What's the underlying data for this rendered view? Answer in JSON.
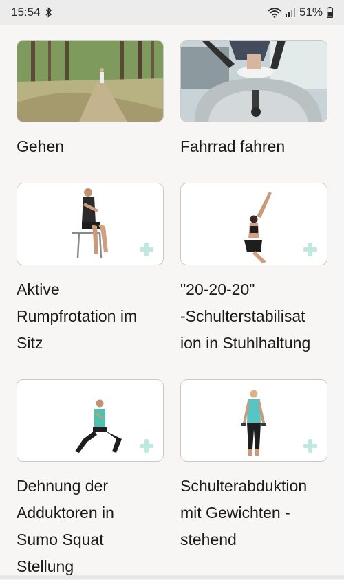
{
  "status_bar": {
    "time": "15:54",
    "battery": "51%",
    "icons": [
      "bluetooth-icon",
      "wifi-icon",
      "signal-icon",
      "battery-icon"
    ]
  },
  "exercises": [
    {
      "title": "Gehen",
      "image": "forest-walking-photo"
    },
    {
      "title": "Fahrrad fahren",
      "image": "exercise-bike-photo"
    },
    {
      "title": "Aktive\nRumpfrotation im\nSitz",
      "image": "seated-rotation-illustration"
    },
    {
      "title": "\"20-20-20\"\n-Schulterstabilisat\nion in Stuhlhaltung",
      "image": "chair-pose-arms-up-illustration"
    },
    {
      "title": "Dehnung der\nAdduktoren in\nSumo Squat\nStellung",
      "image": "sumo-squat-illustration"
    },
    {
      "title": "Schulterabduktion\nmit Gewichten -\nstehend",
      "image": "standing-weights-illustration"
    }
  ],
  "colors": {
    "background": "#f7f6f4",
    "status_bar": "#ececec",
    "card_border": "#c9c9c9",
    "plus_accent": "#bfe9e0"
  }
}
